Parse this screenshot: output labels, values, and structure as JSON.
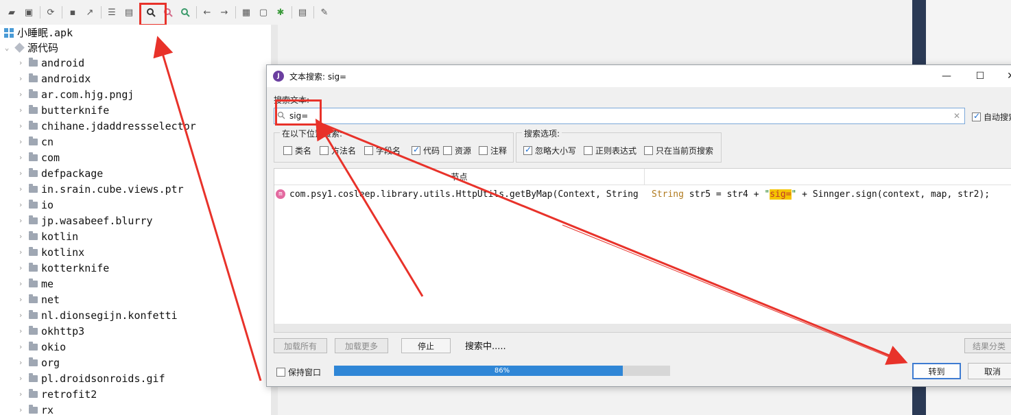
{
  "tree": {
    "root": "小睡眠.apk",
    "sources": "源代码",
    "packages": [
      "android",
      "androidx",
      "ar.com.hjg.pngj",
      "butterknife",
      "chihane.jdaddressselector",
      "cn",
      "com",
      "defpackage",
      "in.srain.cube.views.ptr",
      "io",
      "jp.wasabeef.blurry",
      "kotlin",
      "kotlinx",
      "kotterknife",
      "me",
      "net",
      "nl.dionsegijn.konfetti",
      "okhttp3",
      "okio",
      "org",
      "pl.droidsonroids.gif",
      "retrofit2",
      "rx"
    ]
  },
  "dialog": {
    "title": "文本搜索: sig=",
    "search_label": "搜索文本:",
    "search_value": "sig=",
    "auto_search": "自动搜索",
    "location_group": "在以下位置搜索:",
    "location_options": [
      {
        "label": "类名",
        "checked": false
      },
      {
        "label": "方法名",
        "checked": false
      },
      {
        "label": "字段名",
        "checked": false
      },
      {
        "label": "代码",
        "checked": true
      },
      {
        "label": "资源",
        "checked": false
      },
      {
        "label": "注释",
        "checked": false
      }
    ],
    "options_group": "搜索选项:",
    "search_options": [
      {
        "label": "忽略大小写",
        "checked": true
      },
      {
        "label": "正则表达式",
        "checked": false
      },
      {
        "label": "只在当前页搜索",
        "checked": false
      }
    ],
    "column_node": "节点",
    "result": {
      "node": "com.psy1.cosleep.library.utils.HttpUtils.getByMap(Context, String",
      "code_kw": "String",
      "code_mid": " str5 = str4 + ",
      "code_q1": "\"",
      "code_match": "sig=",
      "code_q2": "\"",
      "code_tail": " + Sinnger.sign(context, map, str2);"
    },
    "btn_load_all": "加载所有",
    "btn_load_more": "加载更多",
    "btn_stop": "停止",
    "status": "搜索中.....",
    "btn_group_results": "结果分类",
    "keep_window": "保持窗口",
    "progress": 86,
    "progress_text": "86%",
    "btn_goto": "转到",
    "btn_cancel": "取消"
  },
  "colors": {
    "accent": "#2f86d6",
    "annotation": "#e8322a"
  }
}
